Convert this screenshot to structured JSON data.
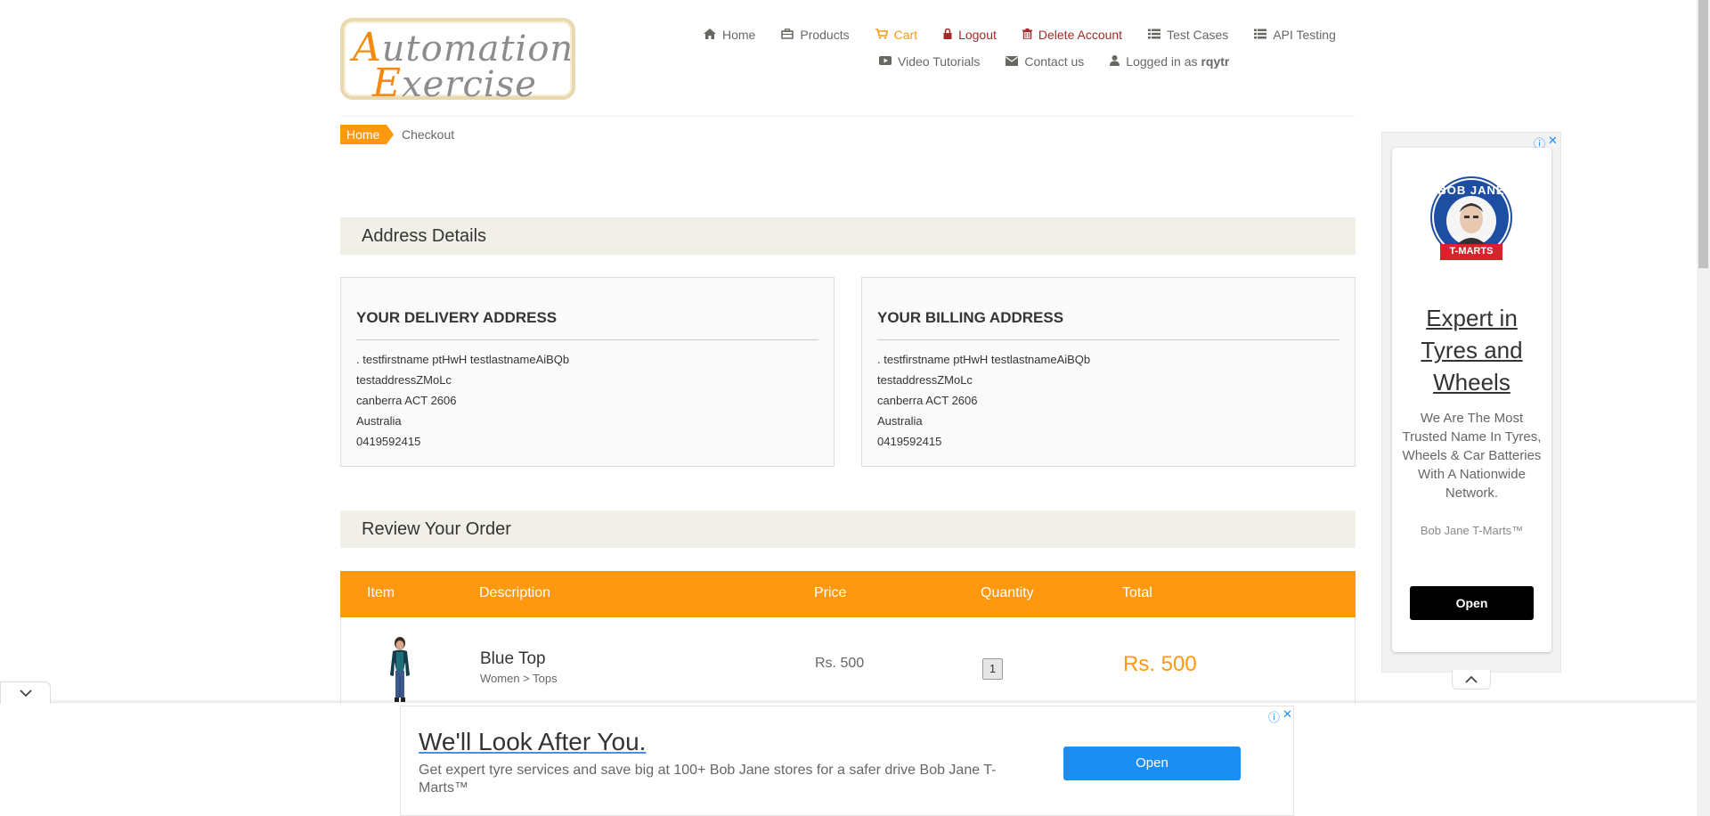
{
  "logo": {
    "line1_cap": "A",
    "line1_rest": "utomation",
    "line2_cap": "E",
    "line2_rest": "xercise"
  },
  "nav": {
    "home": "Home",
    "products": "Products",
    "cart": "Cart",
    "logout": "Logout",
    "delete_account": "Delete Account",
    "test_cases": "Test Cases",
    "api_testing": "API Testing",
    "video_tutorials": "Video Tutorials",
    "contact_us": "Contact us",
    "logged_in_prefix": "Logged in as",
    "username": "rqytr"
  },
  "breadcrumb": {
    "home": "Home",
    "current": "Checkout"
  },
  "address_section": {
    "heading": "Address Details",
    "delivery": {
      "title": "YOUR DELIVERY ADDRESS",
      "name": ". testfirstname ptHwH testlastnameAiBQb",
      "address1": "testaddressZMoLc",
      "city_state_zip": "canberra ACT 2606",
      "country": "Australia",
      "phone": "0419592415"
    },
    "billing": {
      "title": "YOUR BILLING ADDRESS",
      "name": ". testfirstname ptHwH testlastnameAiBQb",
      "address1": "testaddressZMoLc",
      "city_state_zip": "canberra ACT 2606",
      "country": "Australia",
      "phone": "0419592415"
    }
  },
  "review": {
    "heading": "Review Your Order",
    "columns": {
      "item": "Item",
      "description": "Description",
      "price": "Price",
      "quantity": "Quantity",
      "total": "Total"
    },
    "items": [
      {
        "name": "Blue Top",
        "category": "Women > Tops",
        "price": "Rs. 500",
        "quantity": "1",
        "total": "Rs. 500"
      }
    ]
  },
  "side_ad": {
    "brand_logo_top": "BOB JANE",
    "brand_logo_bottom": "T-MARTS",
    "headline": "Expert in Tyres and Wheels",
    "body": "We Are The Most Trusted Name In Tyres, Wheels & Car Batteries With A Nationwide Network.",
    "brand": "Bob Jane T-Marts™",
    "cta": "Open"
  },
  "bottom_ad": {
    "headline": "We'll Look After You.",
    "body": "Get expert tyre services and save big at 100+ Bob Jane stores for a safer drive Bob Jane T-Marts™",
    "cta": "Open"
  },
  "colors": {
    "accent": "#fe980f",
    "danger": "#a52a2a",
    "section_bg": "#f0f0e9",
    "ad_blue": "#1a8ef2"
  },
  "icons": [
    "home-icon",
    "products-icon",
    "cart-icon",
    "lock-icon",
    "trash-icon",
    "list-icon",
    "video-icon",
    "envelope-icon",
    "user-icon",
    "adchoices-icon",
    "close-icon",
    "chevron-down-icon",
    "chevron-up-icon"
  ]
}
